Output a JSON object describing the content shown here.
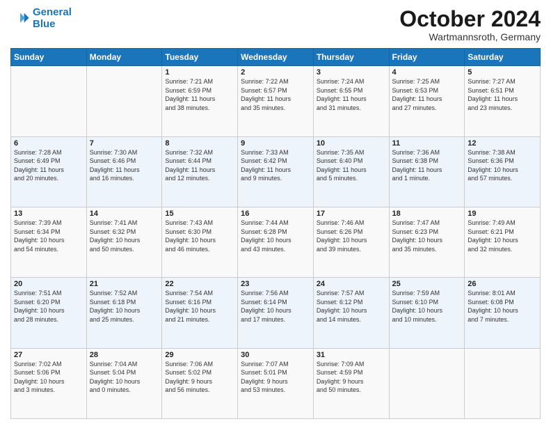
{
  "header": {
    "logo_line1": "General",
    "logo_line2": "Blue",
    "month": "October 2024",
    "location": "Wartmannsroth, Germany"
  },
  "weekdays": [
    "Sunday",
    "Monday",
    "Tuesday",
    "Wednesday",
    "Thursday",
    "Friday",
    "Saturday"
  ],
  "weeks": [
    [
      {
        "day": "",
        "info": ""
      },
      {
        "day": "",
        "info": ""
      },
      {
        "day": "1",
        "info": "Sunrise: 7:21 AM\nSunset: 6:59 PM\nDaylight: 11 hours\nand 38 minutes."
      },
      {
        "day": "2",
        "info": "Sunrise: 7:22 AM\nSunset: 6:57 PM\nDaylight: 11 hours\nand 35 minutes."
      },
      {
        "day": "3",
        "info": "Sunrise: 7:24 AM\nSunset: 6:55 PM\nDaylight: 11 hours\nand 31 minutes."
      },
      {
        "day": "4",
        "info": "Sunrise: 7:25 AM\nSunset: 6:53 PM\nDaylight: 11 hours\nand 27 minutes."
      },
      {
        "day": "5",
        "info": "Sunrise: 7:27 AM\nSunset: 6:51 PM\nDaylight: 11 hours\nand 23 minutes."
      }
    ],
    [
      {
        "day": "6",
        "info": "Sunrise: 7:28 AM\nSunset: 6:49 PM\nDaylight: 11 hours\nand 20 minutes."
      },
      {
        "day": "7",
        "info": "Sunrise: 7:30 AM\nSunset: 6:46 PM\nDaylight: 11 hours\nand 16 minutes."
      },
      {
        "day": "8",
        "info": "Sunrise: 7:32 AM\nSunset: 6:44 PM\nDaylight: 11 hours\nand 12 minutes."
      },
      {
        "day": "9",
        "info": "Sunrise: 7:33 AM\nSunset: 6:42 PM\nDaylight: 11 hours\nand 9 minutes."
      },
      {
        "day": "10",
        "info": "Sunrise: 7:35 AM\nSunset: 6:40 PM\nDaylight: 11 hours\nand 5 minutes."
      },
      {
        "day": "11",
        "info": "Sunrise: 7:36 AM\nSunset: 6:38 PM\nDaylight: 11 hours\nand 1 minute."
      },
      {
        "day": "12",
        "info": "Sunrise: 7:38 AM\nSunset: 6:36 PM\nDaylight: 10 hours\nand 57 minutes."
      }
    ],
    [
      {
        "day": "13",
        "info": "Sunrise: 7:39 AM\nSunset: 6:34 PM\nDaylight: 10 hours\nand 54 minutes."
      },
      {
        "day": "14",
        "info": "Sunrise: 7:41 AM\nSunset: 6:32 PM\nDaylight: 10 hours\nand 50 minutes."
      },
      {
        "day": "15",
        "info": "Sunrise: 7:43 AM\nSunset: 6:30 PM\nDaylight: 10 hours\nand 46 minutes."
      },
      {
        "day": "16",
        "info": "Sunrise: 7:44 AM\nSunset: 6:28 PM\nDaylight: 10 hours\nand 43 minutes."
      },
      {
        "day": "17",
        "info": "Sunrise: 7:46 AM\nSunset: 6:26 PM\nDaylight: 10 hours\nand 39 minutes."
      },
      {
        "day": "18",
        "info": "Sunrise: 7:47 AM\nSunset: 6:23 PM\nDaylight: 10 hours\nand 35 minutes."
      },
      {
        "day": "19",
        "info": "Sunrise: 7:49 AM\nSunset: 6:21 PM\nDaylight: 10 hours\nand 32 minutes."
      }
    ],
    [
      {
        "day": "20",
        "info": "Sunrise: 7:51 AM\nSunset: 6:20 PM\nDaylight: 10 hours\nand 28 minutes."
      },
      {
        "day": "21",
        "info": "Sunrise: 7:52 AM\nSunset: 6:18 PM\nDaylight: 10 hours\nand 25 minutes."
      },
      {
        "day": "22",
        "info": "Sunrise: 7:54 AM\nSunset: 6:16 PM\nDaylight: 10 hours\nand 21 minutes."
      },
      {
        "day": "23",
        "info": "Sunrise: 7:56 AM\nSunset: 6:14 PM\nDaylight: 10 hours\nand 17 minutes."
      },
      {
        "day": "24",
        "info": "Sunrise: 7:57 AM\nSunset: 6:12 PM\nDaylight: 10 hours\nand 14 minutes."
      },
      {
        "day": "25",
        "info": "Sunrise: 7:59 AM\nSunset: 6:10 PM\nDaylight: 10 hours\nand 10 minutes."
      },
      {
        "day": "26",
        "info": "Sunrise: 8:01 AM\nSunset: 6:08 PM\nDaylight: 10 hours\nand 7 minutes."
      }
    ],
    [
      {
        "day": "27",
        "info": "Sunrise: 7:02 AM\nSunset: 5:06 PM\nDaylight: 10 hours\nand 3 minutes."
      },
      {
        "day": "28",
        "info": "Sunrise: 7:04 AM\nSunset: 5:04 PM\nDaylight: 10 hours\nand 0 minutes."
      },
      {
        "day": "29",
        "info": "Sunrise: 7:06 AM\nSunset: 5:02 PM\nDaylight: 9 hours\nand 56 minutes."
      },
      {
        "day": "30",
        "info": "Sunrise: 7:07 AM\nSunset: 5:01 PM\nDaylight: 9 hours\nand 53 minutes."
      },
      {
        "day": "31",
        "info": "Sunrise: 7:09 AM\nSunset: 4:59 PM\nDaylight: 9 hours\nand 50 minutes."
      },
      {
        "day": "",
        "info": ""
      },
      {
        "day": "",
        "info": ""
      }
    ]
  ]
}
